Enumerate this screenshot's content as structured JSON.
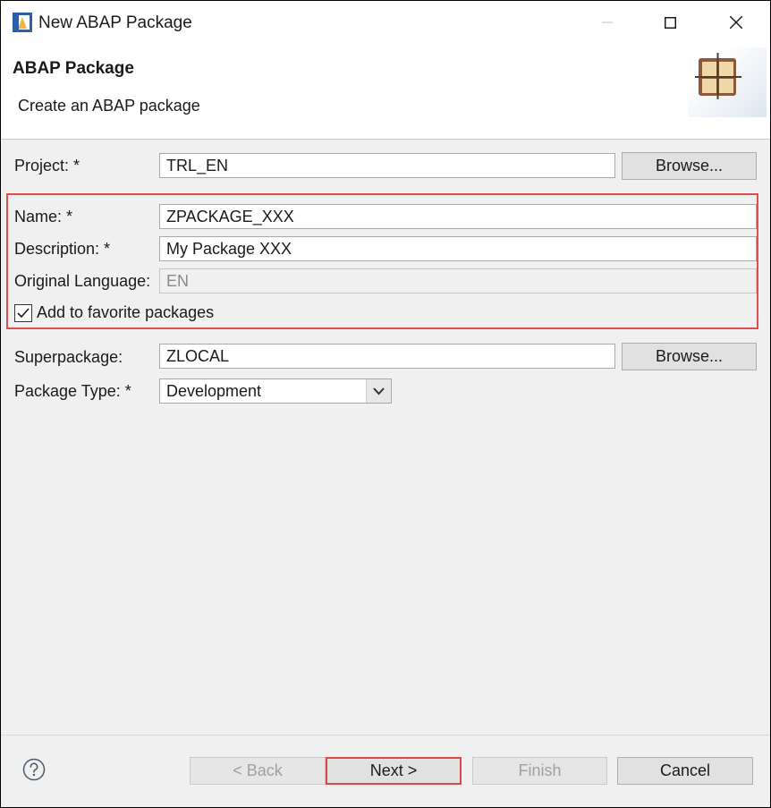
{
  "window": {
    "title": "New ABAP Package",
    "controls": [
      "minimize-icon",
      "maximize-icon",
      "close-icon"
    ]
  },
  "header": {
    "title": "ABAP Package",
    "subtitle": "Create an ABAP package",
    "banner_icon": "package-icon"
  },
  "form": {
    "project": {
      "label": "Project: *",
      "value": "TRL_EN",
      "browse_label": "Browse..."
    },
    "name": {
      "label": "Name: *",
      "value": "ZPACKAGE_XXX"
    },
    "description": {
      "label": "Description: *",
      "value": "My Package XXX"
    },
    "original_language": {
      "label": "Original Language:",
      "value": "EN"
    },
    "favorite": {
      "label": "Add to favorite packages",
      "checked": true
    },
    "superpackage": {
      "label": "Superpackage:",
      "value": "ZLOCAL",
      "browse_label": "Browse..."
    },
    "package_type": {
      "label": "Package Type: *",
      "selected": "Development"
    }
  },
  "footer": {
    "help_icon": "help-icon",
    "back_label": "< Back",
    "next_label": "Next >",
    "finish_label": "Finish",
    "cancel_label": "Cancel"
  },
  "colors": {
    "highlight": "#e24c4c",
    "dialog_bg": "#f0f0f0"
  }
}
